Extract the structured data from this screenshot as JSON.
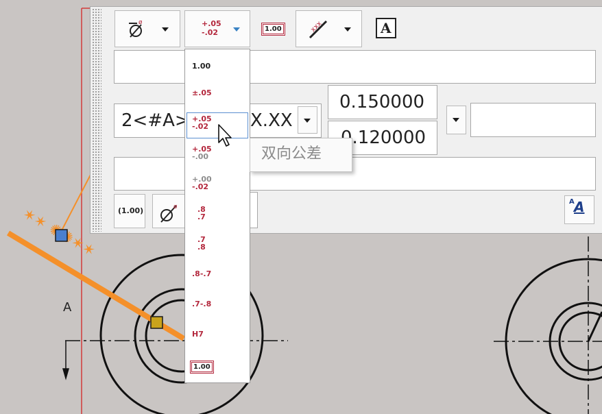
{
  "toolbar": {
    "tolerance_button": {
      "top": "+.05",
      "bottom": "-.02"
    },
    "value_box_label": "1.00",
    "text_a_label": "A",
    "scale_button_label": "A"
  },
  "dimension": {
    "prefix_text": "2<#A>",
    "suffix_text": "X.XX",
    "upper_value": "0.150000",
    "lower_value": "0.120000"
  },
  "bottom_row": {
    "basic_button_label": "(1.00)"
  },
  "dropdown": {
    "items": [
      {
        "kind": "plain",
        "text": "1.00"
      },
      {
        "kind": "single",
        "text": "±.05"
      },
      {
        "kind": "stack",
        "top": "+.05",
        "bottom": "-.02",
        "selected": true
      },
      {
        "kind": "stack",
        "top": "+.05",
        "bottom": "-.00",
        "bottom_gray": true
      },
      {
        "kind": "stack",
        "top": "+.00",
        "bottom": "-.02",
        "top_gray": true
      },
      {
        "kind": "stack",
        "top": ".8",
        "bottom": ".7"
      },
      {
        "kind": "stack",
        "top": ".7",
        "bottom": ".8"
      },
      {
        "kind": "single",
        "text": ".8-.7"
      },
      {
        "kind": "single",
        "text": ".7-.8"
      },
      {
        "kind": "single",
        "text": "H7"
      },
      {
        "kind": "boxed",
        "text": "1.00"
      }
    ]
  },
  "tooltip": {
    "text": "双向公差"
  },
  "drawing": {
    "view_label": "A"
  },
  "colors": {
    "panel": "#f0f0f0",
    "tolerance_red": "#b3273c",
    "annotation_orange": "#f4902a",
    "background": "#c9c5c3"
  }
}
